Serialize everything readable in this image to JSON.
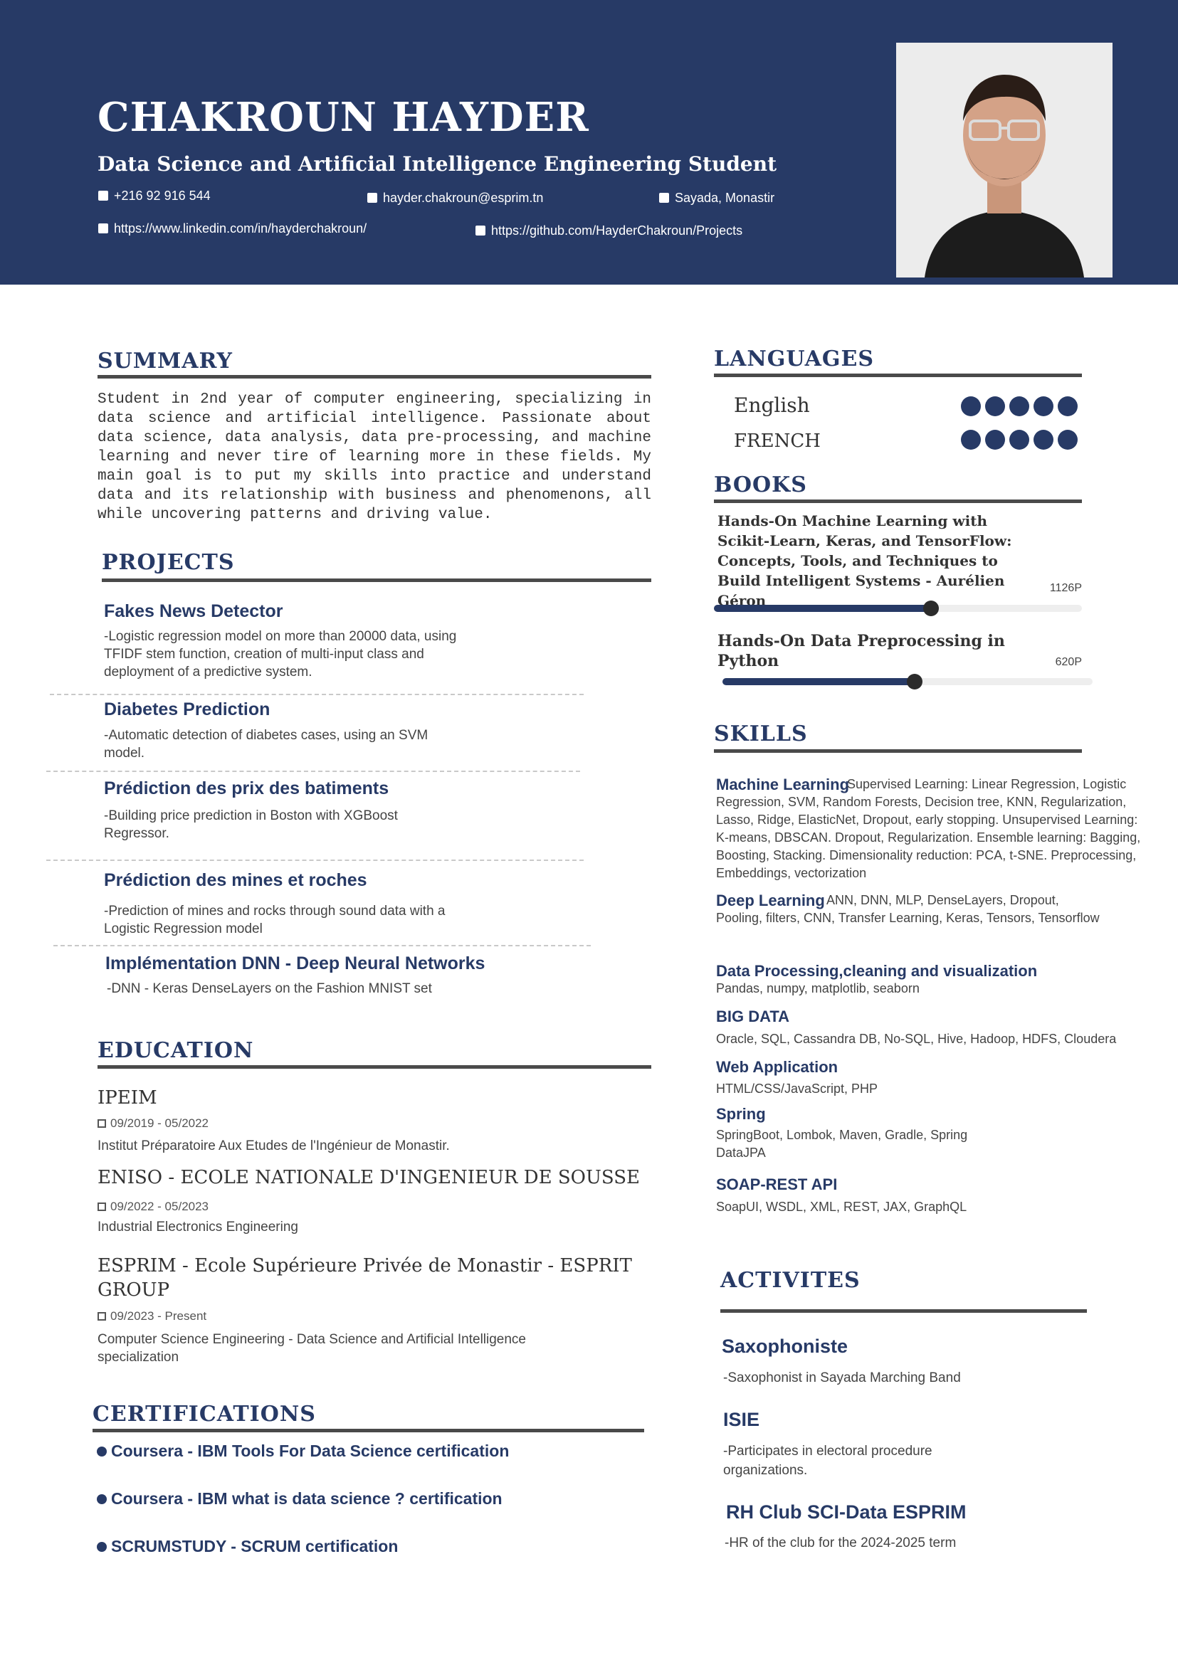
{
  "header": {
    "name": "CHAKROUN HAYDER",
    "subtitle": "Data Science and Artificial Intelligence Engineering Student",
    "phone": "+216 92 916 544",
    "email": "hayder.chakroun@esprim.tn",
    "location": "Sayada, Monastir",
    "linkedin": "https://www.linkedin.com/in/hayderchakroun/",
    "github": "https://github.com/HayderChakroun/Projects"
  },
  "summary": {
    "title": "SUMMARY",
    "text": "Student in 2nd year of computer engineering, specializing in data science and artificial intelligence. Passionate about data science, data analysis, data pre-processing, and machine learning and never tire of learning more in these fields. My main goal is to put my skills into practice and understand data and its relationship with business and phenomenons, all while uncovering patterns and driving value."
  },
  "projects": {
    "title": "PROJECTS",
    "items": [
      {
        "name": "Fakes News Detector",
        "desc": "-Logistic regression model on more than 20000 data, using TFIDF stem function, creation of multi-input class and deployment of a predictive system."
      },
      {
        "name": "Diabetes Prediction",
        "desc": "-Automatic detection of diabetes cases, using an SVM model."
      },
      {
        "name": "Prédiction des prix des batiments",
        "desc": "-Building price prediction in Boston with XGBoost Regressor."
      },
      {
        "name": "Prédiction des mines et roches",
        "desc": "-Prediction of mines and rocks through sound data with a Logistic Regression model"
      },
      {
        "name": "Implémentation DNN - Deep Neural Networks",
        "desc": "-DNN - Keras DenseLayers on the Fashion MNIST set"
      }
    ]
  },
  "education": {
    "title": "EDUCATION",
    "items": [
      {
        "name": "IPEIM",
        "date": "09/2019 - 05/2022",
        "desc": "Institut Préparatoire Aux Etudes de l'Ingénieur de Monastir."
      },
      {
        "name": "ENISO - ECOLE NATIONALE D'INGENIEUR DE SOUSSE",
        "date": "09/2022 - 05/2023",
        "desc": "Industrial Electronics Engineering"
      },
      {
        "name": "ESPRIM - Ecole Supérieure Privée de Monastir - ESPRIT GROUP",
        "date": "09/2023 - Present",
        "desc": "Computer Science Engineering - Data Science and Artificial Intelligence specialization"
      }
    ]
  },
  "certifications": {
    "title": "CERTIFICATIONS",
    "items": [
      "Coursera - IBM Tools For Data Science certification",
      "Coursera - IBM what is data science ? certification",
      "SCRUMSTUDY - SCRUM certification"
    ]
  },
  "languages": {
    "title": "LANGUAGES",
    "items": [
      {
        "name": "English",
        "level": 5,
        "max": 5
      },
      {
        "name": "FRENCH",
        "level": 5,
        "max": 5
      }
    ]
  },
  "books": {
    "title": "BOOKS",
    "items": [
      {
        "title": "Hands-On Machine Learning with Scikit-Learn, Keras, and TensorFlow: Concepts, Tools, and Techniques to Build Intelligent Systems - Aurélien Géron",
        "pages": "1126P",
        "progress": 0.59
      },
      {
        "title": "Hands-On Data Preprocessing in Python",
        "pages": "620P",
        "progress": 0.52
      }
    ]
  },
  "skills": {
    "title": "SKILLS",
    "items": [
      {
        "cat": "Machine Learning",
        "list": "Supervised Learning: Linear Regression, Logistic Regression, SVM, Random Forests, Decision tree, KNN, Regularization, Lasso, Ridge, ElasticNet, Dropout, early stopping. Unsupervised Learning: K-means, DBSCAN. Dropout, Regularization. Ensemble learning: Bagging, Boosting, Stacking. Dimensionality reduction: PCA, t-SNE. Preprocessing, Embeddings, vectorization"
      },
      {
        "cat": "Deep Learning",
        "list": "ANN, DNN, MLP, DenseLayers, Dropout, Pooling, filters, CNN, Transfer Learning, Keras, Tensors, Tensorflow"
      },
      {
        "cat": "Data Processing,cleaning and visualization",
        "list": "Pandas, numpy, matplotlib, seaborn"
      },
      {
        "cat": "BIG DATA",
        "list": "Oracle, SQL, Cassandra DB, No-SQL, Hive, Hadoop, HDFS, Cloudera"
      },
      {
        "cat": "Web Application",
        "list": "HTML/CSS/JavaScript, PHP"
      },
      {
        "cat": "Spring",
        "list": "SpringBoot, Lombok, Maven, Gradle, Spring DataJPA"
      },
      {
        "cat": "SOAP-REST API",
        "list": "SoapUI, WSDL, XML, REST, JAX, GraphQL"
      }
    ]
  },
  "activities": {
    "title": "ACTIVITES",
    "items": [
      {
        "name": "Saxophoniste",
        "desc": "-Saxophonist in Sayada Marching Band"
      },
      {
        "name": "ISIE",
        "desc": "-Participates in electoral procedure organizations."
      },
      {
        "name": "RH Club SCI-Data ESPRIM",
        "desc": "-HR of the club for the 2024-2025 term"
      }
    ]
  }
}
